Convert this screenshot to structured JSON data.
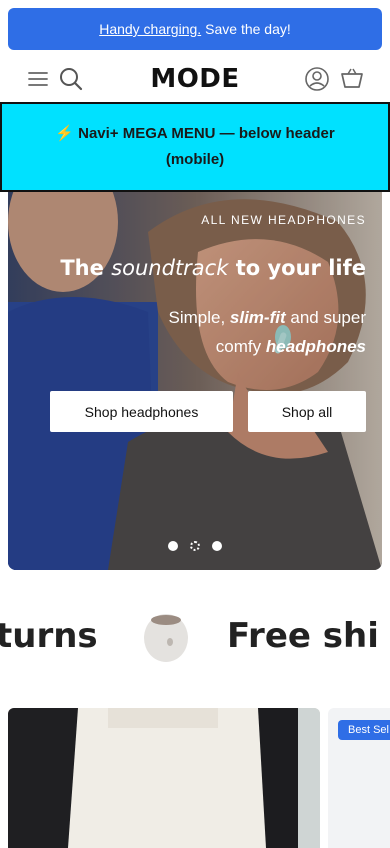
{
  "announcement": {
    "link_text": "Handy charging.",
    "text": "Save the day!"
  },
  "header": {
    "logo": "MODE",
    "icons": [
      "menu-icon",
      "search-icon",
      "account-icon",
      "cart-icon"
    ]
  },
  "mega_menu": {
    "text": "⚡ Navi+ MEGA MENU — below header (mobile)"
  },
  "hero": {
    "eyebrow": "ALL NEW HEADPHONES",
    "title_start": "The",
    "title_italic": "soundtrack",
    "title_end": "to your life",
    "subtitle_1": "Simple,",
    "subtitle_bold_1": "slim-fit",
    "subtitle_2": "and super comfy",
    "subtitle_bold_2": "headphones",
    "buttons": {
      "primary": "Shop headphones",
      "secondary": "Shop all"
    },
    "slides": {
      "count": 3,
      "active_index": 1
    }
  },
  "marquee": {
    "items": [
      "turns",
      "Free shi"
    ]
  },
  "products": {
    "badge": "Best Sel"
  },
  "colors": {
    "accent": "#2f6ee6",
    "mega_bg": "#00e1ff"
  }
}
